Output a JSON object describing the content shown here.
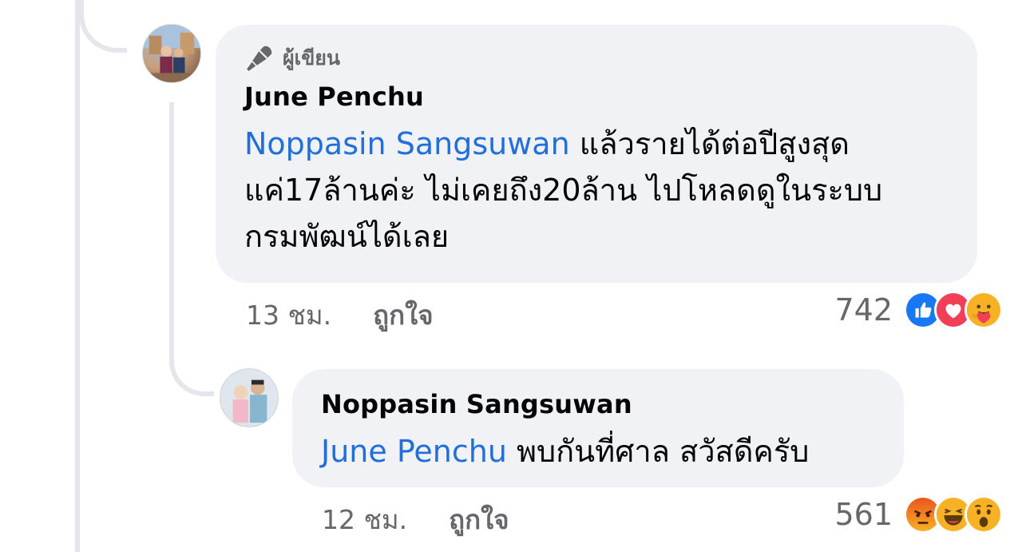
{
  "thread": {
    "comments": [
      {
        "author_badge": "ผู้เขียน",
        "author_badge_icon": "microphone-icon",
        "author": "June Penchu",
        "mention": "Noppasin Sangsuwan",
        "text_line1": " แล้วรายได้ต่อปีสูงสุด",
        "text_line2": "แค่17ล้านค่ะ ไม่เคยถึง20ล้าน ไปโหลดดูในระบบ",
        "text_line3": "กรมพัฒน์ได้เลย",
        "time": "13 ชม.",
        "like_label": "ถูกใจ",
        "reaction_count": "742",
        "reactions": [
          "like-icon",
          "love-icon",
          "care-icon"
        ]
      },
      {
        "author": "Noppasin Sangsuwan",
        "mention": "June Penchu",
        "text": " พบกันที่ศาล สวัสดีครับ",
        "time": "12 ชม.",
        "like_label": "ถูกใจ",
        "reaction_count": "561",
        "reactions": [
          "angry-icon",
          "haha-icon",
          "wow-icon"
        ]
      }
    ]
  },
  "colors": {
    "bubble": "#f0f2f5",
    "mention": "#216fdb",
    "meta": "#65676b",
    "thread_line": "#e4e6eb"
  }
}
